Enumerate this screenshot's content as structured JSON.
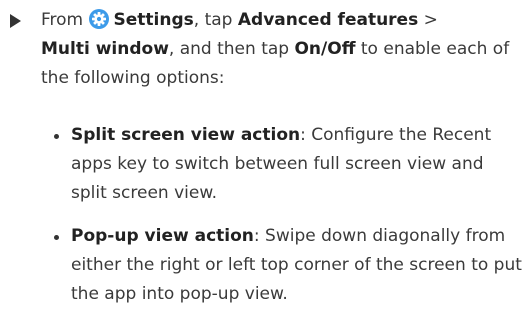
{
  "instruction": {
    "marker_icon": "play-triangle-icon",
    "settings_icon": "settings-gear-icon",
    "settings_icon_color": "#3d9be9",
    "from": "From",
    "settings": "Settings",
    "tap": ", tap",
    "advanced_features": "Advanced features",
    "arrow": " >",
    "multi_window": "Multi window",
    "and_then_tap": ", and then tap",
    "on_off": "On/Off",
    "rest": " to enable each of the following options:"
  },
  "options": [
    {
      "title": "Split screen view action",
      "description": ": Configure the Recent apps key to switch between full screen view and split screen view."
    },
    {
      "title": "Pop-up view action",
      "description": ": Swipe down diagonally from either the right or left top corner of the screen to put the app into pop-up view."
    }
  ]
}
